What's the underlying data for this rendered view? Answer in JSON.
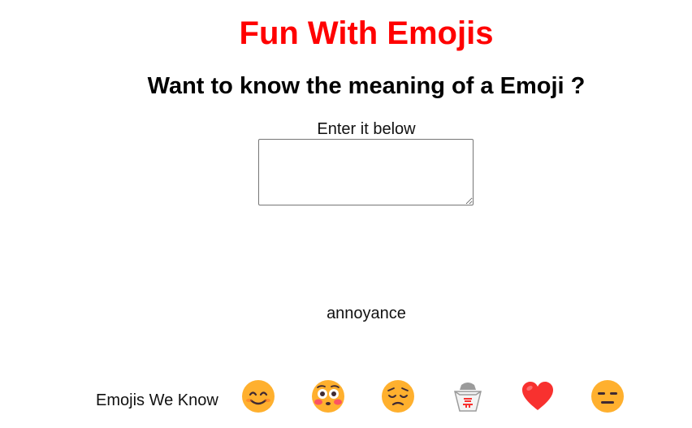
{
  "header": {
    "title": "Fun With Emojis",
    "subtitle": "Want to know the meaning of a Emoji ?"
  },
  "input": {
    "prompt": "Enter it below",
    "value": "",
    "placeholder": ""
  },
  "output": {
    "meaning": "annoyance"
  },
  "known": {
    "label": "Emojis We Know",
    "emojis": [
      {
        "char": "😊",
        "icon": "smiling-face-icon"
      },
      {
        "char": "😳",
        "icon": "flushed-face-icon"
      },
      {
        "char": "😔",
        "icon": "pensive-face-icon"
      },
      {
        "char": "🥡",
        "icon": "takeout-box-icon"
      },
      {
        "char": "❤️",
        "icon": "red-heart-icon"
      },
      {
        "char": "😑",
        "icon": "expressionless-face-icon"
      }
    ]
  },
  "colors": {
    "title": "#ff0000",
    "face": "#ffb02e",
    "heart": "#f8312f"
  }
}
